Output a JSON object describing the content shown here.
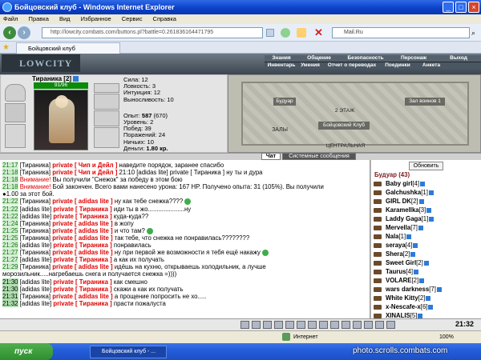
{
  "window": {
    "title": "Бойцовский клуб - Windows Internet Explorer"
  },
  "menubar": [
    "Файл",
    "Правка",
    "Вид",
    "Избранное",
    "Сервис",
    "Справка"
  ],
  "address": {
    "url": "http://lowcity.combats.com/buttons.pl?battle=0.261836164471795",
    "search": "Mail.Ru"
  },
  "tab": {
    "label": "Бойцовский клуб"
  },
  "game": {
    "logo": "LOWCITY",
    "nav_top": [
      "Знания",
      "Общение",
      "Безопасность",
      "Персонаж",
      "Выход"
    ],
    "nav_bottom": [
      "Инвентарь",
      "Умения",
      "Отчет о переводах",
      "Поединки",
      "Анкета"
    ]
  },
  "player": {
    "name": "Тираника",
    "level": "[2]",
    "hp": "91/96",
    "stats": [
      [
        "Сила:",
        "12"
      ],
      [
        "Ловкость:",
        "3"
      ],
      [
        "Интуиция:",
        "12"
      ],
      [
        "Выносливость:",
        "10"
      ]
    ],
    "exp_label": "Опыт:",
    "exp_value": "587",
    "exp_next": "(670)",
    "info": [
      [
        "Уровень:",
        "2"
      ],
      [
        "Побед:",
        "39"
      ],
      [
        "Поражений:",
        "24"
      ],
      [
        "Ничьих:",
        "10"
      ]
    ],
    "money_label": "Деньги:",
    "money_value": "1.80 кр."
  },
  "map": {
    "labels": [
      "Будуар",
      "2 ЭТАЖ",
      "Зал воинов 1",
      "ЗАЛЫ",
      "Бойцовский Клуб",
      "ЦЕНТРАЛЬНАЯ"
    ]
  },
  "chat_tabs": [
    "Чат",
    "Системные сообщения"
  ],
  "chat": [
    {
      "time": "21:17",
      "from": "[Тираника]",
      "priv": "private [ Чип и Дейл ]",
      "text": "наведите порядок, заранее спасибо"
    },
    {
      "time": "21:18",
      "from": "[Тираника]",
      "priv": "private [ Чип и Дейл ]",
      "text": "21:10 [adidas lite] private [ Тираника ] ну ты и дура"
    },
    {
      "time": "21:18",
      "warn": "Внимание!",
      "text": "Вы получили \"Снежок\" за победу в этом бою"
    },
    {
      "time": "21:18",
      "warn": "Внимание!",
      "text": "Бой закончен. Всего вами нанесено урона: 167 HP. Получено опыта: 31 (105%). Вы получили"
    },
    {
      "cont": "●1.00 за этот бой."
    },
    {
      "time": "21:22",
      "from": "[Тираника]",
      "priv": "private [ adidas lite ]",
      "text": "ну как тебе снежка????",
      "smile": true
    },
    {
      "time": "21:22",
      "from": "[adidas lite]",
      "priv": "private [ Тираника ]",
      "text": "иди ты в жо.....................ну"
    },
    {
      "time": "21:22",
      "from": "[adidas lite]",
      "priv": "private [ Тираника ]",
      "text": "куда-куда??"
    },
    {
      "time": "21:24",
      "from": "[Тираника]",
      "priv": "private [ adidas lite ]",
      "text": "в жопу"
    },
    {
      "time": "21:25",
      "from": "[Тираника]",
      "priv": "private [ adidas lite ]",
      "text": "и что там?",
      "smile": true
    },
    {
      "time": "21:25",
      "from": "[Тираника]",
      "priv": "private [ adidas lite ]",
      "text": "так тебе, что снежка не понравилась????????"
    },
    {
      "time": "21:26",
      "from": "[adidas lite]",
      "priv": "private [ Тираника ]",
      "text": "понравилась"
    },
    {
      "time": "21:27",
      "from": "[Тираника]",
      "priv": "private [ adidas lite ]",
      "text": "ну при первой же возможности я тебя ещё накажу",
      "smile": true
    },
    {
      "time": "21:27",
      "from": "[adidas lite]",
      "priv": "private [ Тираника ]",
      "text": "а как их получать"
    },
    {
      "time": "21:29",
      "from": "[Тираника]",
      "priv": "private [ adidas lite ]",
      "text": "идёшь на кухню, открываешь холодильник, а лучше"
    },
    {
      "cont": "морозильник.....нагребаешь снега и получается снежка =))))"
    },
    {
      "time": "21:30",
      "from": "[adidas lite]",
      "priv": "private [ Тираника ]",
      "text": "как смешно"
    },
    {
      "time": "21:30",
      "from": "[adidas lite]",
      "priv": "private [ Тираника ]",
      "text": "скажи а как их получать"
    },
    {
      "time": "21:31",
      "from": "[Тираника]",
      "priv": "private [ adidas lite ]",
      "text": "а прощение попросить не хо....."
    },
    {
      "time": "21:32",
      "from": "[adidas lite]",
      "priv": "private [ Тираника ]",
      "text": "прасти пожалуста"
    }
  ],
  "users": {
    "refresh_label": "Обновить",
    "room": "Будуар",
    "count": "(43)",
    "list": [
      {
        "name": "Baby girl",
        "level": "[4]"
      },
      {
        "name": "Galchushka",
        "level": "[1]"
      },
      {
        "name": "GIRL DK",
        "level": "[2]"
      },
      {
        "name": "Karamellka",
        "level": "[3]"
      },
      {
        "name": "Laddy Gaga",
        "level": "[1]"
      },
      {
        "name": "Mervella",
        "level": "[7]"
      },
      {
        "name": "Nala",
        "level": "[1]"
      },
      {
        "name": "seraya",
        "level": "[4]"
      },
      {
        "name": "Shera",
        "level": "[2]"
      },
      {
        "name": "Sweet Girl",
        "level": "[2]"
      },
      {
        "name": "Taurus",
        "level": "[4]"
      },
      {
        "name": "VOLARE",
        "level": "[2]"
      },
      {
        "name": "wars darkness",
        "level": "[7]"
      },
      {
        "name": "White Kitty",
        "level": "[2]"
      },
      {
        "name": "x-Nescafe-x",
        "level": "[6]"
      },
      {
        "name": "XINALIS",
        "level": "[5]"
      }
    ]
  },
  "toolbar": {
    "clock": "21:32"
  },
  "statusbar": {
    "zone": "Интернет",
    "zoom": "100%"
  },
  "taskbar": {
    "start": "пуск",
    "item": "Бойцовский клуб - ..."
  },
  "watermark": "photo.scrolls.combats.com"
}
